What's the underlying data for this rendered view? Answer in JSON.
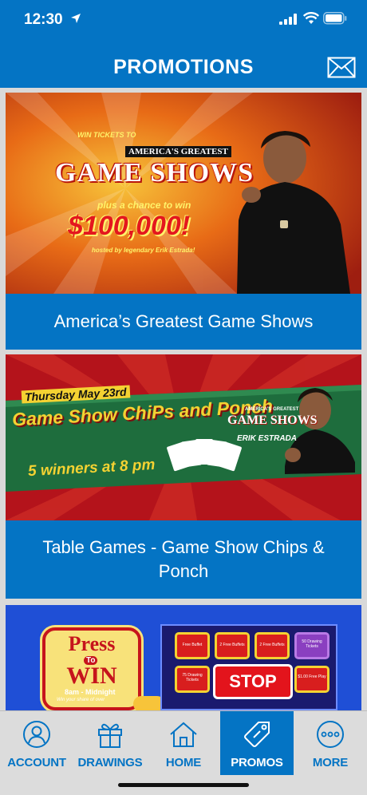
{
  "status_bar": {
    "time": "12:30"
  },
  "header": {
    "title": "PROMOTIONS",
    "icon": "mail-icon"
  },
  "promos": [
    {
      "caption": "America’s Greatest Game Shows",
      "banner": {
        "kicker": "WIN TICKETS TO",
        "brand": "AMERICA'S GREATEST",
        "headline": "GAME SHOWS",
        "subline": "plus a chance to win",
        "amount": "$100,000!",
        "credit": "hosted by legendary Erik Estrada!"
      }
    },
    {
      "caption": "Table Games - Game Show Chips & Ponch",
      "banner": {
        "date": "Thursday May 23rd",
        "headline": "Game Show ChiPs and Ponch",
        "brand": "AMERICA'S GREATEST",
        "logo": "GAME SHOWS",
        "name": "ERIK ESTRADA",
        "winners": "5 winners at 8 pm"
      }
    },
    {
      "caption": "",
      "banner": {
        "press": "Press",
        "to": "To",
        "win": "WIN",
        "hours": "8am - Midnight",
        "share": "Win your share of over",
        "stop": "STOP",
        "tiles": [
          "Free Buffet",
          "2 Free Buffets",
          "2 Free Buffets",
          "50 Drawing Tickets",
          "75 Drawing Tickets",
          "",
          "",
          "$1.00 Free Play"
        ]
      }
    }
  ],
  "tabs": [
    {
      "label": "ACCOUNT",
      "icon": "account-icon",
      "active": false
    },
    {
      "label": "DRAWINGS",
      "icon": "gift-icon",
      "active": false
    },
    {
      "label": "HOME",
      "icon": "home-icon",
      "active": false
    },
    {
      "label": "PROMOS",
      "icon": "tag-icon",
      "active": true
    },
    {
      "label": "MORE",
      "icon": "more-icon",
      "active": false
    }
  ],
  "colors": {
    "brand": "#0474c4",
    "tabbar": "#dcdcdc"
  }
}
